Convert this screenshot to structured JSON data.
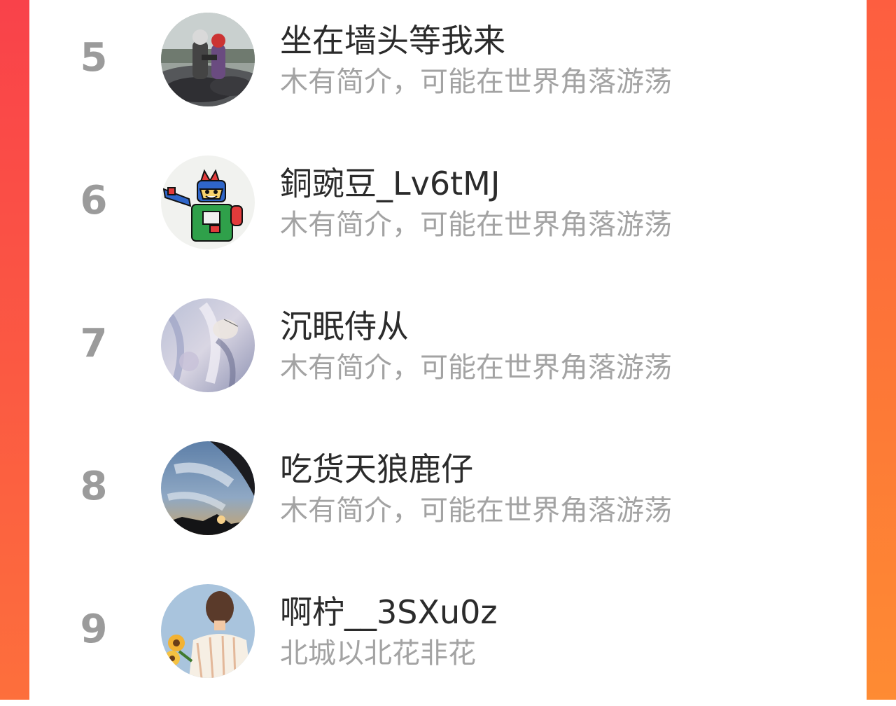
{
  "ranking": {
    "items": [
      {
        "rank": "5",
        "name": "坐在墙头等我来",
        "bio": "木有简介，可能在世界角落游荡",
        "avatar_icon": "motorcycle-couple-photo"
      },
      {
        "rank": "6",
        "name": "銅豌豆_Lv6tMJ",
        "bio": "木有简介，可能在世界角落游荡",
        "avatar_icon": "cartoon-robot-hero"
      },
      {
        "rank": "7",
        "name": "沉眠侍从",
        "bio": "木有简介，可能在世界角落游荡",
        "avatar_icon": "anime-illustration"
      },
      {
        "rank": "8",
        "name": "吃货天狼鹿仔",
        "bio": "木有简介，可能在世界角落游荡",
        "avatar_icon": "sky-sunset-photo"
      },
      {
        "rank": "9",
        "name": "啊柠__3SXu0z",
        "bio": "北城以北花非花",
        "avatar_icon": "boy-with-sunflowers-illustration"
      }
    ]
  },
  "colors": {
    "accent_left": "#f9424a",
    "accent_right": "#fe8b33",
    "rank_color": "#9b9b9b",
    "name_color": "#2b2b2b",
    "bio_color": "#a3a3a3"
  }
}
